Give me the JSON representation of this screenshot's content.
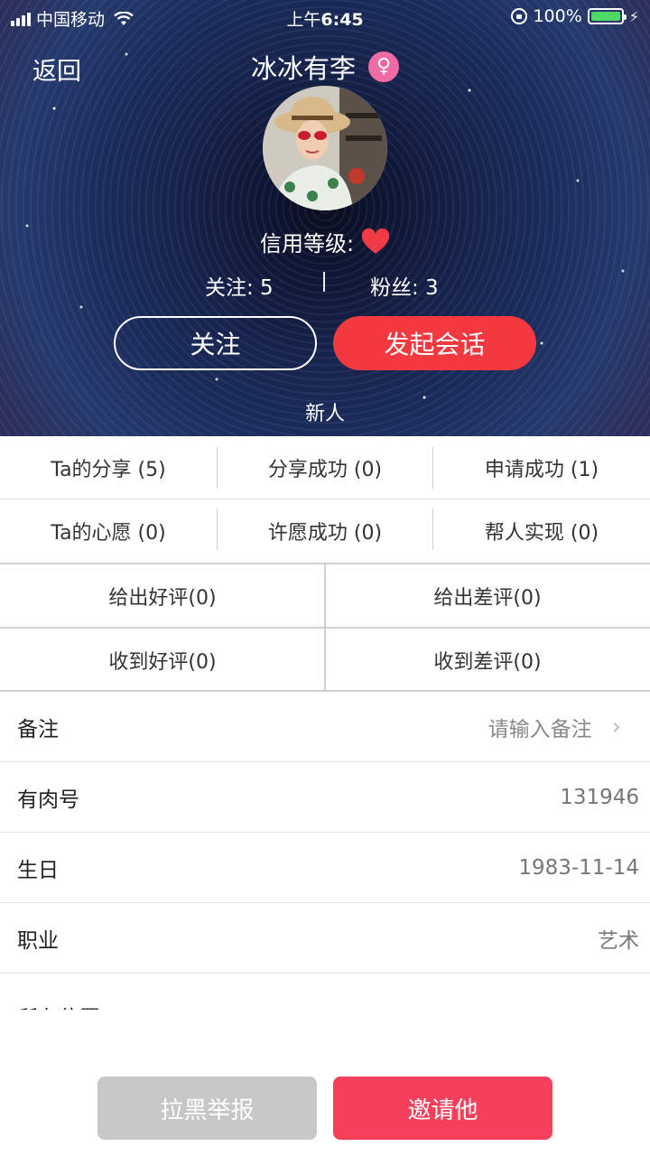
{
  "status_bar": {
    "carrier": "中国移动",
    "time_prefix": "上午",
    "time": "6:45",
    "battery": "100%"
  },
  "header": {
    "back_label": "返回",
    "title": "冰冰有李",
    "gender_icon": "female-icon"
  },
  "profile": {
    "credit_label": "信用等级:",
    "follow_label": "关注: 5",
    "fans_label": "粉丝: 3",
    "follow_button": "关注",
    "chat_button": "发起会话",
    "tag": "新人"
  },
  "activity_grid": {
    "row1": [
      "Ta的分享 (5)",
      "分享成功 (0)",
      "申请成功 (1)"
    ],
    "row2": [
      "Ta的心愿 (0)",
      "许愿成功 (0)",
      "帮人实现 (0)"
    ]
  },
  "review_grid": {
    "row1": [
      "给出好评(0)",
      "给出差评(0)"
    ],
    "row2": [
      "收到好评(0)",
      "收到差评(0)"
    ]
  },
  "info": {
    "note": {
      "label": "备注",
      "placeholder": "请输入备注"
    },
    "id": {
      "label": "有肉号",
      "value": "131946"
    },
    "birthday": {
      "label": "生日",
      "value": "1983-11-14"
    },
    "job": {
      "label": "职业",
      "value": "艺术"
    },
    "location": {
      "label": "所在位置"
    }
  },
  "footer": {
    "block_button": "拉黑举报",
    "invite_button": "邀请他"
  },
  "colors": {
    "accent_red": "#f3383f",
    "invite_red": "#f4405a",
    "female_pink": "#f06aa6",
    "battery_green": "#4cd964"
  }
}
